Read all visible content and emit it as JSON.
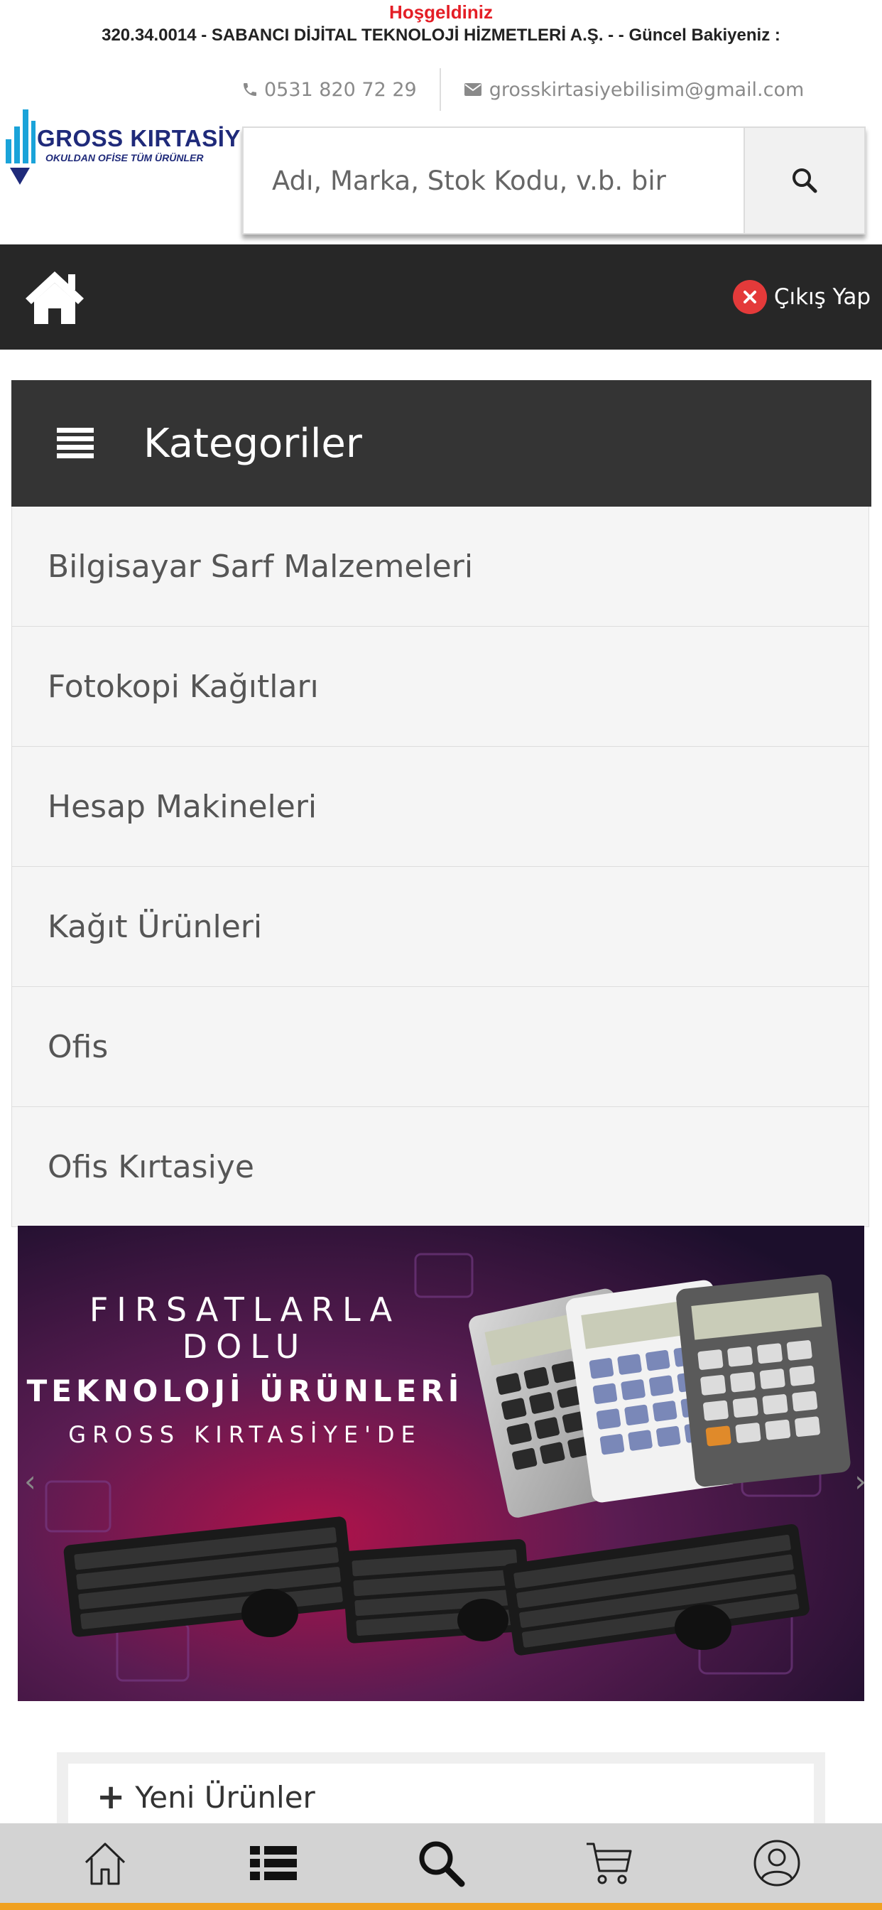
{
  "header": {
    "welcome": "Hoşgeldiniz",
    "account_line": "320.34.0014 - SABANCI DİJİTAL TEKNOLOJİ HİZMETLERİ A.Ş. - - Güncel Bakiyeniz :",
    "phone": "0531 820 72 29",
    "email": "grosskirtasiyebilisim@gmail.com"
  },
  "logo": {
    "line1": "GROSS KIRTASİYE",
    "line2": "OKULDAN OFİSE TÜM ÜRÜNLER"
  },
  "search": {
    "placeholder": "Adı, Marka, Stok Kodu, v.b. bir"
  },
  "nav": {
    "logout_label": "Çıkış Yap"
  },
  "categories": {
    "title": "Kategoriler",
    "items": [
      "Bilgisayar Sarf Malzemeleri",
      "Fotokopi Kağıtları",
      "Hesap Makineleri",
      "Kağıt Ürünleri",
      "Ofis",
      "Ofis Kırtasiye"
    ]
  },
  "banner": {
    "line1": "FIRSATLARLA",
    "line2": "DOLU",
    "line3": "TEKNOLOJİ ÜRÜNLERİ",
    "line4": "GROSS KIRTASİYE'DE",
    "prev": "‹",
    "next": "›"
  },
  "sections": {
    "new_products_plus": "+",
    "new_products": "Yeni Ürünler"
  },
  "colors": {
    "welcome_red": "#e41e26",
    "nav_dark": "#272727",
    "category_header": "#343434",
    "logout_red": "#e43a3a",
    "bottom_accent": "#f0a020"
  },
  "icons": {
    "phone": "phone-icon",
    "email": "envelope-icon",
    "search": "search-icon",
    "home": "home-icon",
    "logout": "close-circle-icon",
    "menu": "hamburger-menu-icon",
    "bottom_nav": [
      "home-icon",
      "list-icon",
      "search-icon",
      "cart-icon",
      "user-icon"
    ]
  }
}
